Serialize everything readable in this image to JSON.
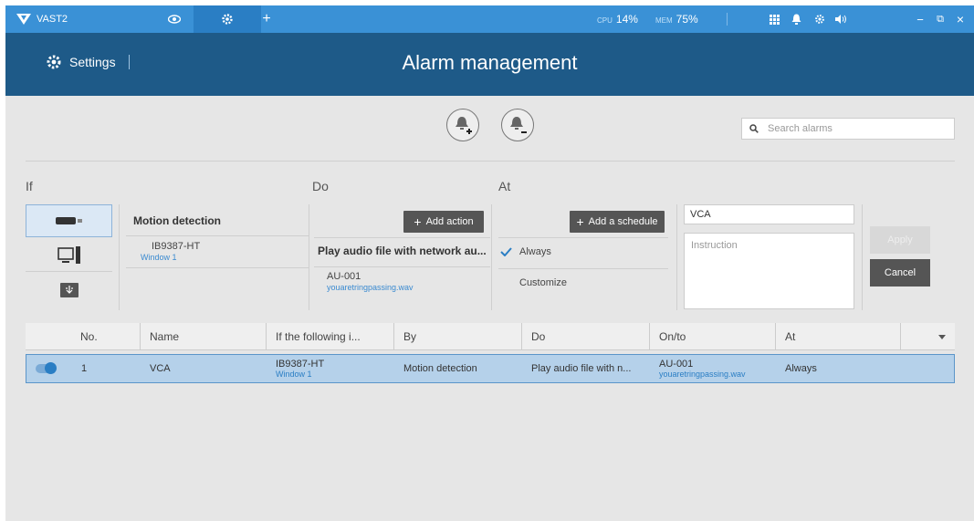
{
  "topbar": {
    "app_name": "VAST2",
    "tabs": [
      {
        "icon": "eye-icon"
      },
      {
        "icon": "gear-icon",
        "active": true
      },
      {
        "label": "+"
      }
    ],
    "cpu_label": "CPU",
    "cpu_value": "14%",
    "mem_label": "MEM",
    "mem_value": "75%",
    "icons": [
      "grid-icon",
      "bell-icon",
      "gear-icon",
      "speaker-icon",
      "minimize-icon",
      "restore-icon",
      "close-icon"
    ],
    "minimize": "−",
    "restore": "⧉",
    "close": "×"
  },
  "header": {
    "settings_label": "Settings",
    "title": "Alarm management"
  },
  "search": {
    "placeholder": "Search alarms"
  },
  "sections": {
    "if": "If",
    "do": "Do",
    "at": "At"
  },
  "trigger": {
    "title": "Motion detection",
    "device": "IB9387-HT",
    "device_sub": "Window 1"
  },
  "action": {
    "add_label": "Add action",
    "title": "Play audio file with network au...",
    "device": "AU-001",
    "file": "youaretringpassing.wav"
  },
  "schedule": {
    "add_label": "Add a schedule",
    "items": [
      "Always",
      "Customize"
    ],
    "selected": "Always"
  },
  "form": {
    "name_value": "VCA",
    "instruction_placeholder": "Instruction",
    "apply_label": "Apply",
    "cancel_label": "Cancel"
  },
  "table": {
    "columns": [
      "No.",
      "Name",
      "If the following i...",
      "By",
      "Do",
      "On/to",
      "At"
    ],
    "rows": [
      {
        "enabled": true,
        "no": "1",
        "name": "VCA",
        "if_main": "IB9387-HT",
        "if_sub": "Window 1",
        "by": "Motion detection",
        "do": "Play audio file with n...",
        "on_main": "AU-001",
        "on_sub": "youaretringpassing.wav",
        "at": "Always"
      }
    ]
  },
  "colors": {
    "topbar": "#3a91d6",
    "header": "#1e5a88",
    "accent": "#2a7ec4",
    "row_selected": "#b5d1ea"
  }
}
